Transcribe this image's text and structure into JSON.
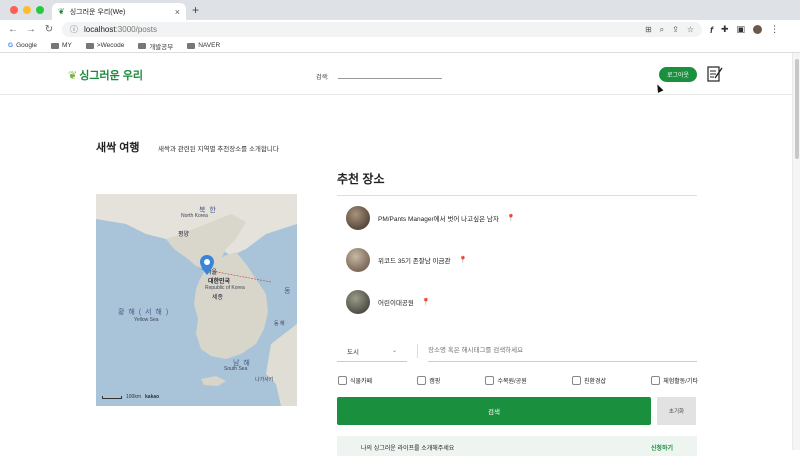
{
  "browser": {
    "tab_title": "싱그러운 우리(We)",
    "tab_close": "×",
    "new_tab": "+",
    "url_host": "localhost",
    "url_path": ":3000/posts",
    "bookmarks": [
      {
        "label": "Google",
        "icon": "google-icon"
      },
      {
        "label": "MY",
        "icon": "folder-icon"
      },
      {
        "label": ">Wecode",
        "icon": "folder-icon"
      },
      {
        "label": "개발공부",
        "icon": "folder-icon"
      },
      {
        "label": "NAVER",
        "icon": "folder-icon"
      }
    ],
    "colors": {
      "red": "#ff5f57",
      "yellow": "#febc2e",
      "green": "#28c840"
    }
  },
  "header": {
    "logo_text": "싱그러운 우리",
    "search_label": "검색:",
    "logout_label": "로그아웃",
    "brand_color": "#1a8f3e"
  },
  "intro": {
    "title": "새싹 여행",
    "subtitle": "새싹과 관련된 지역별 추천장소를 소개합니다"
  },
  "map": {
    "labels": {
      "north": "북 한",
      "north_en": "North Korea",
      "pyongyang": "평양",
      "seoul": "서울",
      "south": "대한민국",
      "south_en": "Republic of Korea",
      "sejong": "세종",
      "yellow_sea": "황 해 ( 서 해 )",
      "yellow_sea_en": "Yellow Sea",
      "south_sea": "남 해",
      "south_sea_en": "South Sea",
      "east": "동",
      "east_sea": "동 해",
      "nagasaki": "나가사키",
      "scale": "100km",
      "kakao": "kakao"
    }
  },
  "recommend": {
    "title": "추천 장소",
    "places": [
      {
        "name": "PM/Pants Manager에서 벗어 나고싶은 남자"
      },
      {
        "name": "위코드 35기 존잘남 이금관"
      },
      {
        "name": "어린이대공원"
      }
    ]
  },
  "filter": {
    "city_label": "도시",
    "search_placeholder": "장소명 혹은 해시태그를 검색하세요",
    "categories": [
      "식물카페",
      "캠핑",
      "수목원/공원",
      "친환경샵",
      "체험활동/기타"
    ],
    "search_button": "검색",
    "reset_button": "초기화"
  },
  "banner": {
    "text": "나의 싱그러운 라이프를 소개해주세요",
    "link": "신청하기"
  }
}
